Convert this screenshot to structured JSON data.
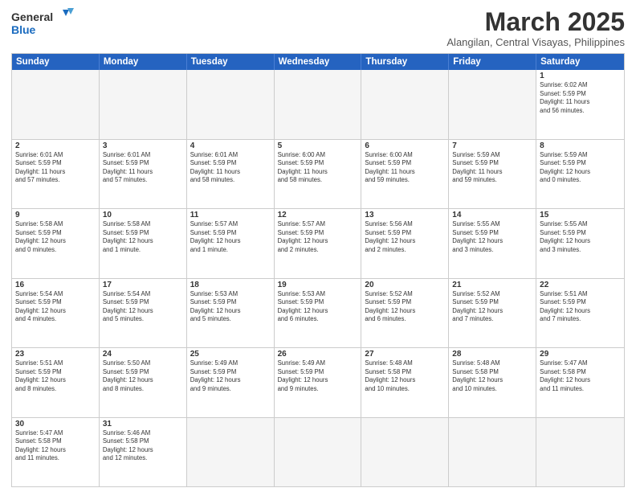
{
  "header": {
    "logo_general": "General",
    "logo_blue": "Blue",
    "month_title": "March 2025",
    "subtitle": "Alangilan, Central Visayas, Philippines"
  },
  "day_headers": [
    "Sunday",
    "Monday",
    "Tuesday",
    "Wednesday",
    "Thursday",
    "Friday",
    "Saturday"
  ],
  "weeks": [
    [
      {
        "day": "",
        "info": "",
        "empty": true
      },
      {
        "day": "",
        "info": "",
        "empty": true
      },
      {
        "day": "",
        "info": "",
        "empty": true
      },
      {
        "day": "",
        "info": "",
        "empty": true
      },
      {
        "day": "",
        "info": "",
        "empty": true
      },
      {
        "day": "",
        "info": "",
        "empty": true
      },
      {
        "day": "1",
        "info": "Sunrise: 6:02 AM\nSunset: 5:59 PM\nDaylight: 11 hours\nand 56 minutes.",
        "empty": false
      }
    ],
    [
      {
        "day": "2",
        "info": "Sunrise: 6:01 AM\nSunset: 5:59 PM\nDaylight: 11 hours\nand 57 minutes.",
        "empty": false
      },
      {
        "day": "3",
        "info": "Sunrise: 6:01 AM\nSunset: 5:59 PM\nDaylight: 11 hours\nand 57 minutes.",
        "empty": false
      },
      {
        "day": "4",
        "info": "Sunrise: 6:01 AM\nSunset: 5:59 PM\nDaylight: 11 hours\nand 58 minutes.",
        "empty": false
      },
      {
        "day": "5",
        "info": "Sunrise: 6:00 AM\nSunset: 5:59 PM\nDaylight: 11 hours\nand 58 minutes.",
        "empty": false
      },
      {
        "day": "6",
        "info": "Sunrise: 6:00 AM\nSunset: 5:59 PM\nDaylight: 11 hours\nand 59 minutes.",
        "empty": false
      },
      {
        "day": "7",
        "info": "Sunrise: 5:59 AM\nSunset: 5:59 PM\nDaylight: 11 hours\nand 59 minutes.",
        "empty": false
      },
      {
        "day": "8",
        "info": "Sunrise: 5:59 AM\nSunset: 5:59 PM\nDaylight: 12 hours\nand 0 minutes.",
        "empty": false
      }
    ],
    [
      {
        "day": "9",
        "info": "Sunrise: 5:58 AM\nSunset: 5:59 PM\nDaylight: 12 hours\nand 0 minutes.",
        "empty": false
      },
      {
        "day": "10",
        "info": "Sunrise: 5:58 AM\nSunset: 5:59 PM\nDaylight: 12 hours\nand 1 minute.",
        "empty": false
      },
      {
        "day": "11",
        "info": "Sunrise: 5:57 AM\nSunset: 5:59 PM\nDaylight: 12 hours\nand 1 minute.",
        "empty": false
      },
      {
        "day": "12",
        "info": "Sunrise: 5:57 AM\nSunset: 5:59 PM\nDaylight: 12 hours\nand 2 minutes.",
        "empty": false
      },
      {
        "day": "13",
        "info": "Sunrise: 5:56 AM\nSunset: 5:59 PM\nDaylight: 12 hours\nand 2 minutes.",
        "empty": false
      },
      {
        "day": "14",
        "info": "Sunrise: 5:55 AM\nSunset: 5:59 PM\nDaylight: 12 hours\nand 3 minutes.",
        "empty": false
      },
      {
        "day": "15",
        "info": "Sunrise: 5:55 AM\nSunset: 5:59 PM\nDaylight: 12 hours\nand 3 minutes.",
        "empty": false
      }
    ],
    [
      {
        "day": "16",
        "info": "Sunrise: 5:54 AM\nSunset: 5:59 PM\nDaylight: 12 hours\nand 4 minutes.",
        "empty": false
      },
      {
        "day": "17",
        "info": "Sunrise: 5:54 AM\nSunset: 5:59 PM\nDaylight: 12 hours\nand 5 minutes.",
        "empty": false
      },
      {
        "day": "18",
        "info": "Sunrise: 5:53 AM\nSunset: 5:59 PM\nDaylight: 12 hours\nand 5 minutes.",
        "empty": false
      },
      {
        "day": "19",
        "info": "Sunrise: 5:53 AM\nSunset: 5:59 PM\nDaylight: 12 hours\nand 6 minutes.",
        "empty": false
      },
      {
        "day": "20",
        "info": "Sunrise: 5:52 AM\nSunset: 5:59 PM\nDaylight: 12 hours\nand 6 minutes.",
        "empty": false
      },
      {
        "day": "21",
        "info": "Sunrise: 5:52 AM\nSunset: 5:59 PM\nDaylight: 12 hours\nand 7 minutes.",
        "empty": false
      },
      {
        "day": "22",
        "info": "Sunrise: 5:51 AM\nSunset: 5:59 PM\nDaylight: 12 hours\nand 7 minutes.",
        "empty": false
      }
    ],
    [
      {
        "day": "23",
        "info": "Sunrise: 5:51 AM\nSunset: 5:59 PM\nDaylight: 12 hours\nand 8 minutes.",
        "empty": false
      },
      {
        "day": "24",
        "info": "Sunrise: 5:50 AM\nSunset: 5:59 PM\nDaylight: 12 hours\nand 8 minutes.",
        "empty": false
      },
      {
        "day": "25",
        "info": "Sunrise: 5:49 AM\nSunset: 5:59 PM\nDaylight: 12 hours\nand 9 minutes.",
        "empty": false
      },
      {
        "day": "26",
        "info": "Sunrise: 5:49 AM\nSunset: 5:59 PM\nDaylight: 12 hours\nand 9 minutes.",
        "empty": false
      },
      {
        "day": "27",
        "info": "Sunrise: 5:48 AM\nSunset: 5:58 PM\nDaylight: 12 hours\nand 10 minutes.",
        "empty": false
      },
      {
        "day": "28",
        "info": "Sunrise: 5:48 AM\nSunset: 5:58 PM\nDaylight: 12 hours\nand 10 minutes.",
        "empty": false
      },
      {
        "day": "29",
        "info": "Sunrise: 5:47 AM\nSunset: 5:58 PM\nDaylight: 12 hours\nand 11 minutes.",
        "empty": false
      }
    ],
    [
      {
        "day": "30",
        "info": "Sunrise: 5:47 AM\nSunset: 5:58 PM\nDaylight: 12 hours\nand 11 minutes.",
        "empty": false
      },
      {
        "day": "31",
        "info": "Sunrise: 5:46 AM\nSunset: 5:58 PM\nDaylight: 12 hours\nand 12 minutes.",
        "empty": false
      },
      {
        "day": "",
        "info": "",
        "empty": true
      },
      {
        "day": "",
        "info": "",
        "empty": true
      },
      {
        "day": "",
        "info": "",
        "empty": true
      },
      {
        "day": "",
        "info": "",
        "empty": true
      },
      {
        "day": "",
        "info": "",
        "empty": true
      }
    ]
  ]
}
